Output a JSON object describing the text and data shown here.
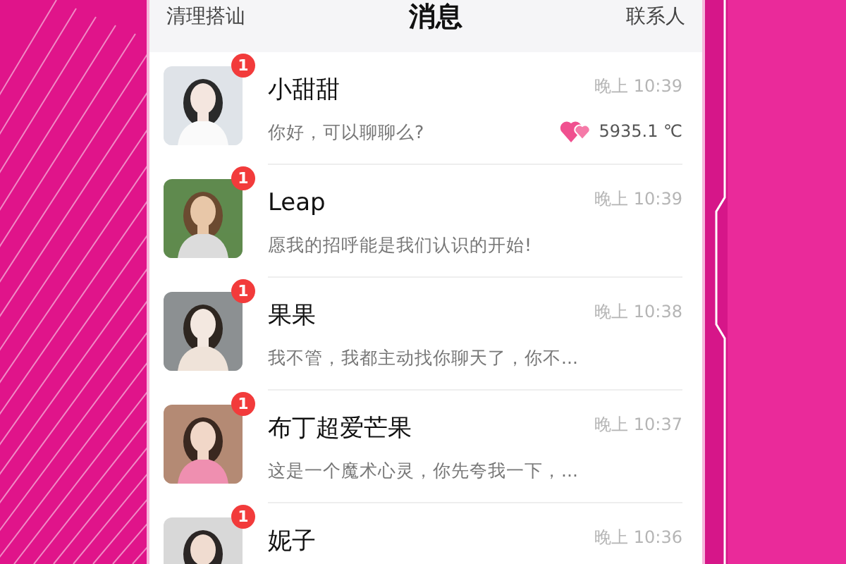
{
  "header": {
    "left_action": "清理搭讪",
    "title": "消息",
    "right_action": "联系人"
  },
  "conversations": [
    {
      "name": "小甜甜",
      "message": "你好，可以聊聊么?",
      "time": "晚上 10:39",
      "unread": "1",
      "intimacy": "5935.1 ℃"
    },
    {
      "name": "Leap",
      "message": "愿我的招呼能是我们认识的开始!",
      "time": "晚上 10:39",
      "unread": "1"
    },
    {
      "name": "果果",
      "message": "我不管，我都主动找你聊天了，你不...",
      "time": "晚上 10:38",
      "unread": "1"
    },
    {
      "name": "布丁超爱芒果",
      "message": "这是一个魔术心灵，你先夸我一下，...",
      "time": "晚上 10:37",
      "unread": "1"
    },
    {
      "name": "妮子",
      "time": "晚上 10:36",
      "unread": "1"
    }
  ]
}
